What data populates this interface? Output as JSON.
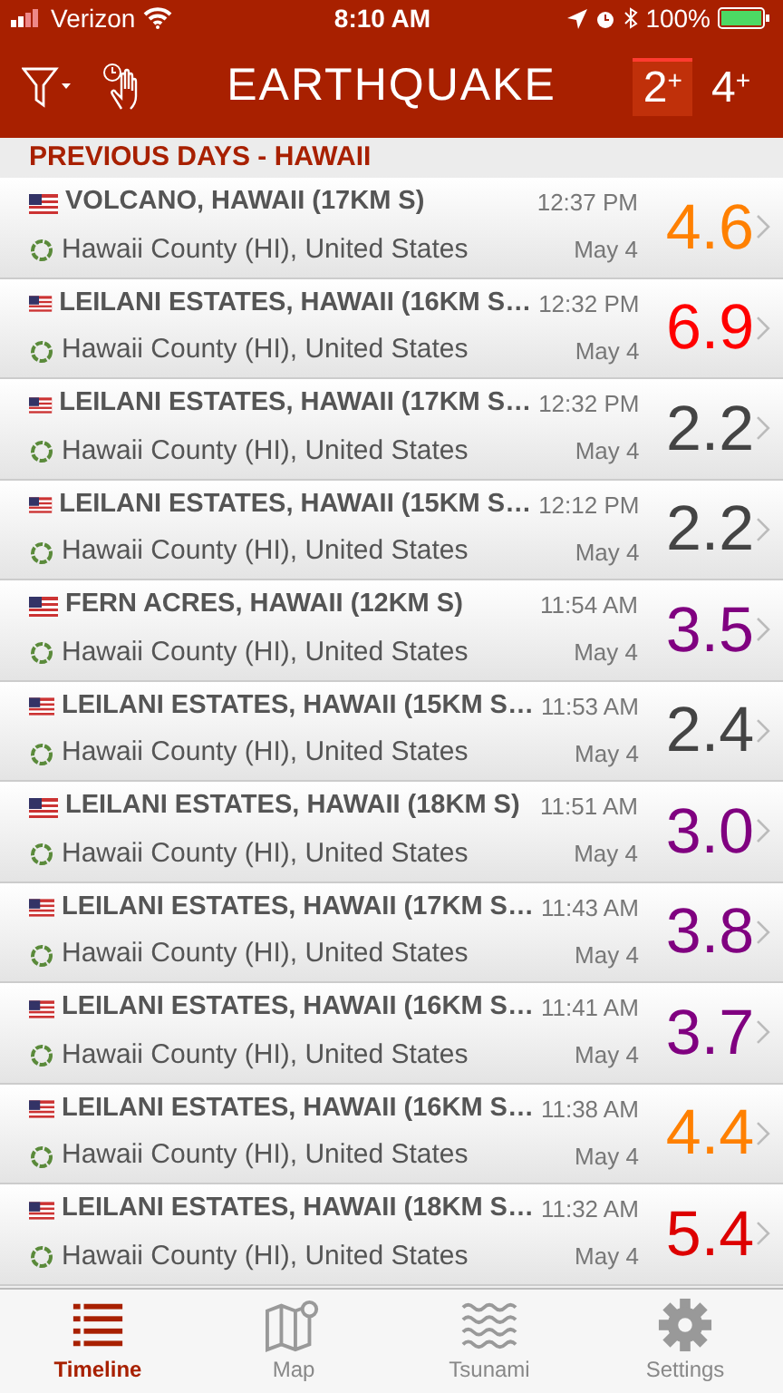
{
  "status_bar": {
    "carrier": "Verizon",
    "time": "8:10 AM",
    "battery": "100%"
  },
  "nav": {
    "title": "EARTHQUAKE",
    "magnitude_filters": [
      {
        "label": "2",
        "sup": "+",
        "selected": true
      },
      {
        "label": "4",
        "sup": "+",
        "selected": false
      }
    ]
  },
  "section": {
    "title": "PREVIOUS DAYS - HAWAII"
  },
  "quakes": [
    {
      "title": "VOLCANO, HAWAII (17KM S)",
      "location": "Hawaii County (HI), United States",
      "time": "12:37 PM",
      "date": "May 4",
      "magnitude": "4.6",
      "color": "#ff8000"
    },
    {
      "title": "LEILANI ESTATES, HAWAII (16KM S…",
      "location": "Hawaii County (HI), United States",
      "time": "12:32 PM",
      "date": "May 4",
      "magnitude": "6.9",
      "color": "#ff0000"
    },
    {
      "title": "LEILANI ESTATES, HAWAII (17KM S…",
      "location": "Hawaii County (HI), United States",
      "time": "12:32 PM",
      "date": "May 4",
      "magnitude": "2.2",
      "color": "#444444"
    },
    {
      "title": "LEILANI ESTATES, HAWAII (15KM S…",
      "location": "Hawaii County (HI), United States",
      "time": "12:12 PM",
      "date": "May 4",
      "magnitude": "2.2",
      "color": "#444444"
    },
    {
      "title": "FERN ACRES, HAWAII (12KM S)",
      "location": "Hawaii County (HI), United States",
      "time": "11:54 AM",
      "date": "May 4",
      "magnitude": "3.5",
      "color": "#800080"
    },
    {
      "title": "LEILANI ESTATES, HAWAII (15KM S…",
      "location": "Hawaii County (HI), United States",
      "time": "11:53 AM",
      "date": "May 4",
      "magnitude": "2.4",
      "color": "#444444"
    },
    {
      "title": "LEILANI ESTATES, HAWAII (18KM S)",
      "location": "Hawaii County (HI), United States",
      "time": "11:51 AM",
      "date": "May 4",
      "magnitude": "3.0",
      "color": "#800080"
    },
    {
      "title": "LEILANI ESTATES, HAWAII (17KM S…",
      "location": "Hawaii County (HI), United States",
      "time": "11:43 AM",
      "date": "May 4",
      "magnitude": "3.8",
      "color": "#800080"
    },
    {
      "title": "LEILANI ESTATES, HAWAII (16KM S…",
      "location": "Hawaii County (HI), United States",
      "time": "11:41 AM",
      "date": "May 4",
      "magnitude": "3.7",
      "color": "#800080"
    },
    {
      "title": "LEILANI ESTATES, HAWAII (16KM S…",
      "location": "Hawaii County (HI), United States",
      "time": "11:38 AM",
      "date": "May 4",
      "magnitude": "4.4",
      "color": "#ff8000"
    },
    {
      "title": "LEILANI ESTATES, HAWAII (18KM S…",
      "location": "Hawaii County (HI), United States",
      "time": "11:32 AM",
      "date": "May 4",
      "magnitude": "5.4",
      "color": "#dd0000"
    }
  ],
  "tabs": [
    {
      "label": "Timeline",
      "kind": "timeline",
      "selected": true
    },
    {
      "label": "Map",
      "kind": "map",
      "selected": false
    },
    {
      "label": "Tsunami",
      "kind": "tsunami",
      "selected": false
    },
    {
      "label": "Settings",
      "kind": "settings",
      "selected": false
    }
  ]
}
